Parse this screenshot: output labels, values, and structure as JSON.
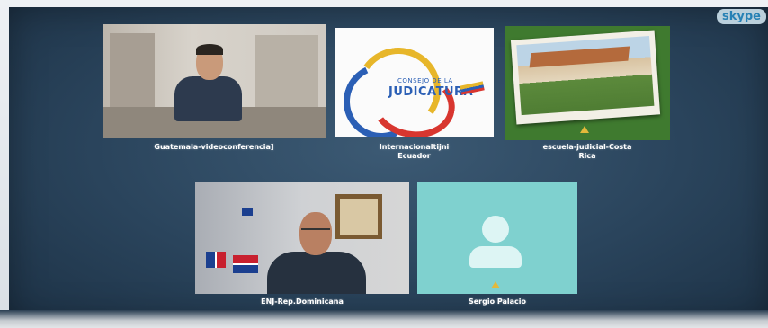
{
  "app": {
    "logo_text": "skype"
  },
  "participants": [
    {
      "name": "Guatemala-videoconferencia]",
      "avatar": "camera-feed"
    },
    {
      "name": "Internacionaltijni\nEcuador",
      "avatar": "logo-consejo-judicatura",
      "logo_line1": "CONSEJO DE LA",
      "logo_line2": "JUDICATURA"
    },
    {
      "name": "escuela-judicial-Costa\nRica",
      "avatar": "photo-building"
    },
    {
      "name": "ENJ-Rep.Dominicana",
      "avatar": "camera-feed"
    },
    {
      "name": "Sergio Palacio",
      "avatar": "default-avatar"
    }
  ],
  "colors": {
    "background": "#2a445c",
    "default_avatar_bg": "#7fd1cf",
    "caption_text": "#ffffff"
  }
}
